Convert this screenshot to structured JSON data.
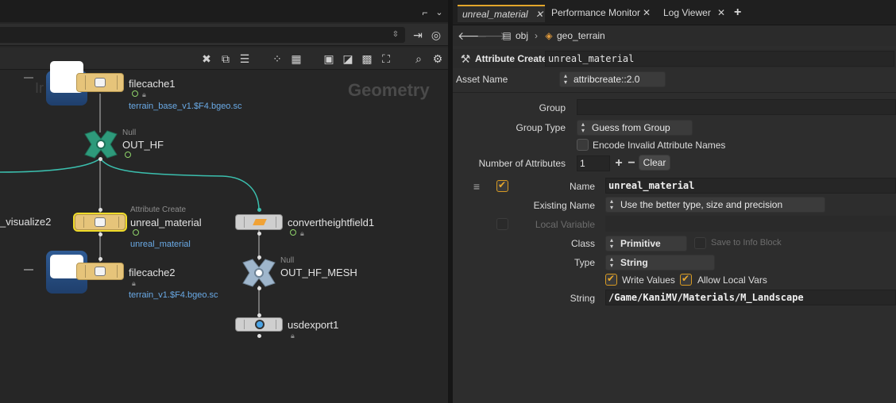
{
  "left_panel": {
    "context_label": "Geometry",
    "ghost_label": "Ir",
    "nodes": {
      "filecache1": {
        "name": "filecache1",
        "comment": "terrain_base_v1.$F4.bgeo.sc"
      },
      "out_hf": {
        "type": "Null",
        "name": "OUT_HF"
      },
      "visualize2": {
        "name": "_visualize2"
      },
      "unreal_material": {
        "type": "Attribute Create",
        "name": "unreal_material",
        "comment": "unreal_material"
      },
      "convertheightfield1": {
        "name": "convertheightfield1"
      },
      "filecache2": {
        "name": "filecache2",
        "comment": "terrain_v1.$F4.bgeo.sc"
      },
      "out_hf_mesh": {
        "type": "Null",
        "name": "OUT_HF_MESH"
      },
      "usdexport1": {
        "name": "usdexport1"
      }
    }
  },
  "right_panel": {
    "tabs": [
      {
        "label": "unreal_material",
        "active": true
      },
      {
        "label": "Performance Monitor",
        "active": false
      },
      {
        "label": "Log Viewer",
        "active": false
      }
    ],
    "add_tab": "+",
    "breadcrumb": {
      "root": "obj",
      "child": "geo_terrain"
    },
    "node_type": "Attribute Create",
    "node_name": "unreal_material",
    "asset_name_label": "Asset Name",
    "asset_name": "attribcreate::2.0",
    "params": {
      "group_label": "Group",
      "group_value": "",
      "group_type_label": "Group Type",
      "group_type_value": "Guess from Group",
      "encode_label": "Encode Invalid Attribute Names",
      "num_attr_label": "Number of Attributes",
      "num_attr_value": "1",
      "clear_label": "Clear",
      "name_label": "Name",
      "name_value": "unreal_material",
      "existing_name_label": "Existing Name",
      "existing_name_value": "Use the better type, size and precision",
      "local_var_label": "Local Variable",
      "class_label": "Class",
      "class_value": "Primitive",
      "save_info_label": "Save to Info Block",
      "type_label": "Type",
      "type_value": "String",
      "write_values_label": "Write Values",
      "allow_local_vars_label": "Allow Local Vars",
      "string_label": "String",
      "string_value": "/Game/KaniMV/Materials/M_Landscape"
    }
  },
  "colors": {
    "accent": "#e3a62b",
    "selected_outline": "#f0dc2a",
    "wire": "#8c8c8c",
    "wire_highlight": "#3bbfae",
    "comment_blue": "#6aaae6"
  }
}
